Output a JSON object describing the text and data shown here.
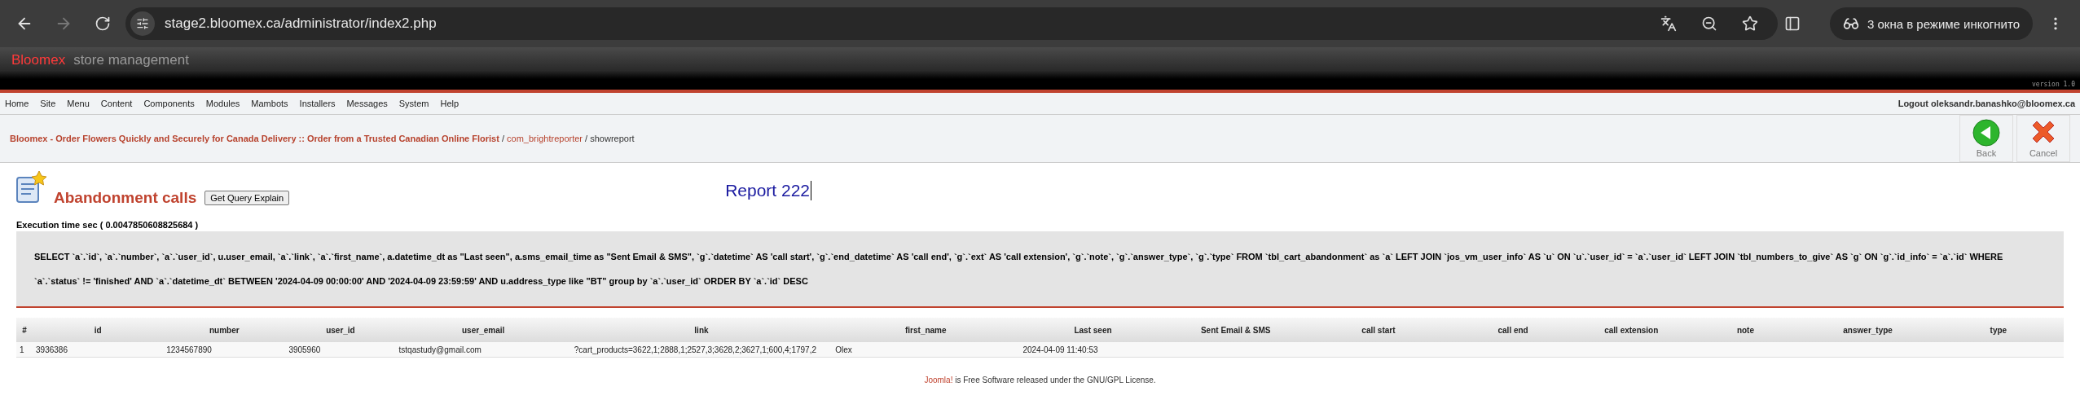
{
  "browser": {
    "url": "stage2.bloomex.ca/administrator/index2.php",
    "incognito": "3 окна в режиме инкогнито"
  },
  "header": {
    "brand": "Bloomex",
    "subtitle": "store management",
    "version": "version 1.0"
  },
  "menu": [
    "Home",
    "Site",
    "Menu",
    "Content",
    "Components",
    "Modules",
    "Mambots",
    "Installers",
    "Messages",
    "System",
    "Help"
  ],
  "logout": "Logout oleksandr.banashko@bloomex.ca",
  "breadcrumb_separator": "/",
  "breadcrumb": [
    {
      "label": "Bloomex - Order Flowers Quickly and Securely for Canada Delivery :: Order from a Trusted Canadian Online Florist",
      "kind": "site"
    },
    {
      "label": "com_brightreporter",
      "kind": "link"
    },
    {
      "label": "showreport",
      "kind": "current"
    }
  ],
  "toolbar": [
    {
      "label": "Back",
      "kind": "back"
    },
    {
      "label": "Cancel",
      "kind": "cancel"
    }
  ],
  "report": {
    "heading": "Abandonment calls",
    "explain_button": "Get Query Explain",
    "title": "Report 222",
    "execution_time": "Execution time sec ( 0.0047850608825684 )",
    "query": "SELECT `a`.`id`, `a`.`number`, `a`.`user_id`, u.user_email, `a`.`link`, `a`.`first_name`, a.datetime_dt as \"Last seen\", a.sms_email_time as \"Sent Email & SMS\", `g`.`datetime` AS 'call start', `g`.`end_datetime` AS 'call end', `g`.`ext` AS 'call extension', `g`.`note`, `g`.`answer_type`, `g`.`type` FROM `tbl_cart_abandonment` as `a` LEFT JOIN `jos_vm_user_info` AS `u` ON `u`.`user_id` = `a`.`user_id` LEFT JOIN `tbl_numbers_to_give` AS `g` ON `g`.`id_info` = `a`.`id` WHERE `a`.`status` != 'finished' AND `a`.`datetime_dt` BETWEEN '2024-04-09 00:00:00' AND '2024-04-09 23:59:59' AND u.address_type like \"BT\" group by `a`.`user_id` ORDER BY `a`.`id` DESC"
  },
  "table": {
    "columns": [
      "#",
      "id",
      "number",
      "user_id",
      "user_email",
      "link",
      "first_name",
      "Last seen",
      "Sent Email & SMS",
      "call start",
      "call end",
      "call extension",
      "note",
      "answer_type",
      "type"
    ],
    "rows": [
      [
        "1",
        "3936386",
        "1234567890",
        "3905960",
        "tstqastudy@gmail.com",
        "?cart_products=3622,1;2888,1;2527,3;3628,2;3627,1;600,4;1797,2",
        "Olex",
        "2024-04-09 11:40:53"
      ]
    ]
  },
  "footer": {
    "link": "Joomla!",
    "text": " is Free Software released under the GNU/GPL License."
  }
}
